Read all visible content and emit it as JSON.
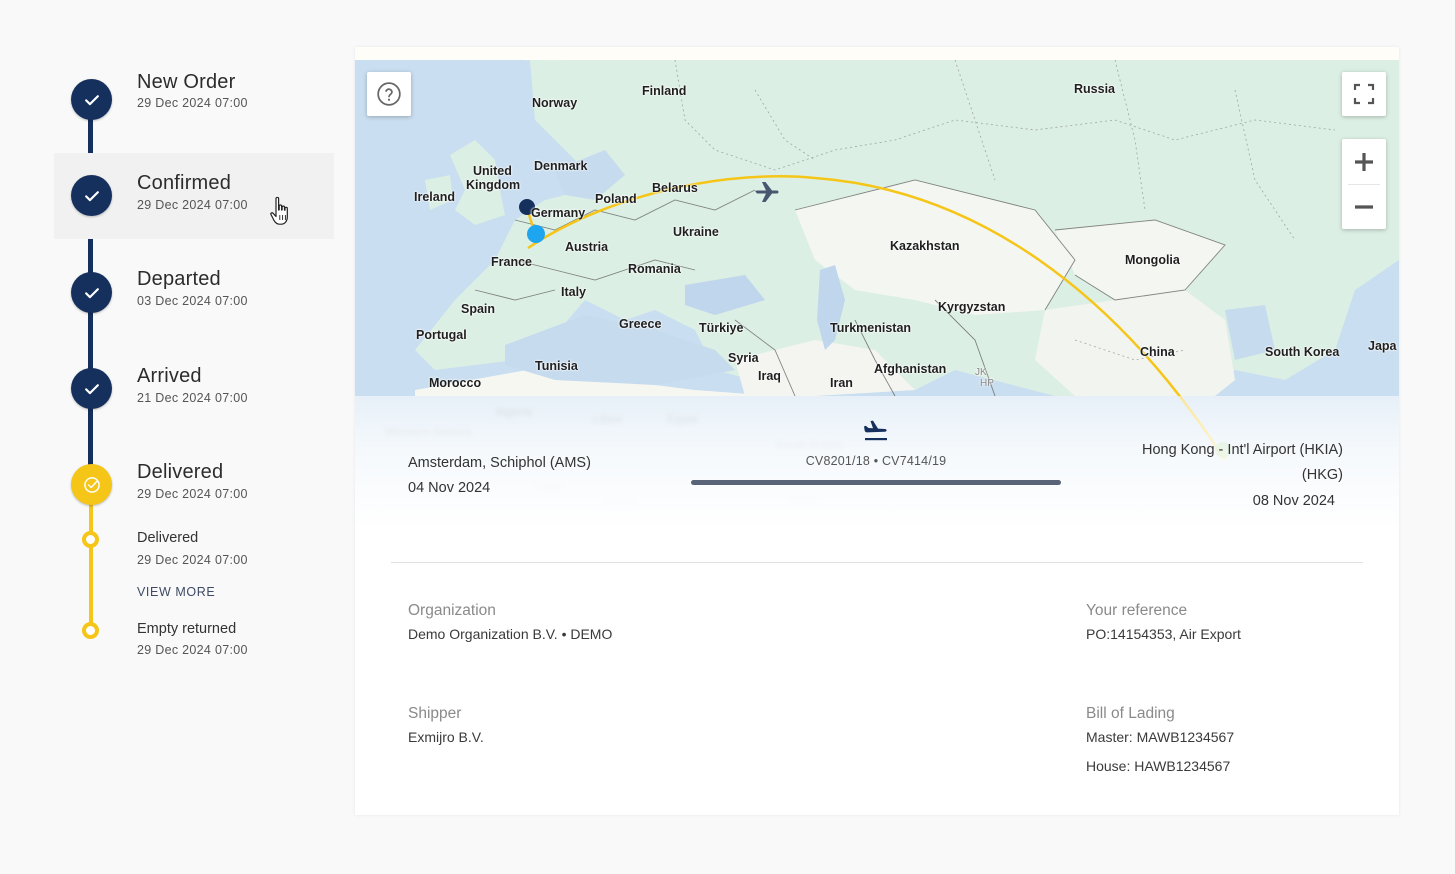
{
  "timeline": {
    "steps": [
      {
        "title": "New Order",
        "date": "29 Dec 2024 07:00",
        "status": "completed",
        "icon": "check-icon"
      },
      {
        "title": "Confirmed",
        "date": "29 Dec 2024 07:00",
        "status": "completed",
        "icon": "check-icon"
      },
      {
        "title": "Departed",
        "date": "03 Dec 2024 07:00",
        "status": "completed",
        "icon": "check-icon"
      },
      {
        "title": "Arrived",
        "date": "21 Dec 2024 07:00",
        "status": "completed",
        "icon": "check-icon"
      },
      {
        "title": "Delivered",
        "date": "29 Dec 2024 07:00",
        "status": "current",
        "icon": "check-circle-icon"
      }
    ],
    "substeps": [
      {
        "title": "Delivered",
        "date": "29 Dec 2024 07:00"
      },
      {
        "title": "Empty returned",
        "date": "29 Dec 2024 07:00"
      }
    ],
    "view_more_label": "VIEW MORE",
    "colors": {
      "completed": "#15305d",
      "current": "#f5c518"
    }
  },
  "map": {
    "help_icon": "question-circle-icon",
    "fullscreen_icon": "fullscreen-icon",
    "zoom_in_icon": "plus-icon",
    "zoom_out_icon": "minus-icon",
    "route_color": "#f5c518",
    "labels": [
      {
        "name": "Finland"
      },
      {
        "name": "Norway"
      },
      {
        "name": "Russia"
      },
      {
        "name": "Denmark"
      },
      {
        "name": "United"
      },
      {
        "name": "Kingdom"
      },
      {
        "name": "Ireland"
      },
      {
        "name": "Germany"
      },
      {
        "name": "Poland"
      },
      {
        "name": "Belarus"
      },
      {
        "name": "Ukraine"
      },
      {
        "name": "Austria"
      },
      {
        "name": "France"
      },
      {
        "name": "Romania"
      },
      {
        "name": "Italy"
      },
      {
        "name": "Spain"
      },
      {
        "name": "Portugal"
      },
      {
        "name": "Greece"
      },
      {
        "name": "Türkiye"
      },
      {
        "name": "Tunisia"
      },
      {
        "name": "Morocco"
      },
      {
        "name": "Syria"
      },
      {
        "name": "Iraq"
      },
      {
        "name": "Iran"
      },
      {
        "name": "Afghanistan"
      },
      {
        "name": "Turkmenistan"
      },
      {
        "name": "Kyrgyzstan"
      },
      {
        "name": "Kazakhstan"
      },
      {
        "name": "Mongolia"
      },
      {
        "name": "China"
      },
      {
        "name": "South Korea"
      },
      {
        "name": "Japa"
      },
      {
        "name": "JK"
      },
      {
        "name": "HP"
      }
    ]
  },
  "route": {
    "origin": {
      "place": "Amsterdam, Schiphol (AMS)",
      "date": "04 Nov 2024"
    },
    "mode_icon": "flight-land-icon",
    "flights": "CV8201/18 • CV7414/19",
    "progress": 1.0,
    "destination": {
      "place_line1": "Hong Kong - Int'l Airport (HKIA)",
      "place_line2": "(HKG)",
      "date": "08 Nov 2024"
    }
  },
  "details": {
    "organization": {
      "label": "Organization",
      "value": "Demo Organization B.V. • DEMO"
    },
    "reference": {
      "label": "Your reference",
      "value": "PO:14154353, Air Export"
    },
    "shipper": {
      "label": "Shipper",
      "value": "Exmijro B.V."
    },
    "bill_of_lading": {
      "label": "Bill of Lading",
      "master": "Master: MAWB1234567",
      "house": "House: HAWB1234567"
    }
  }
}
